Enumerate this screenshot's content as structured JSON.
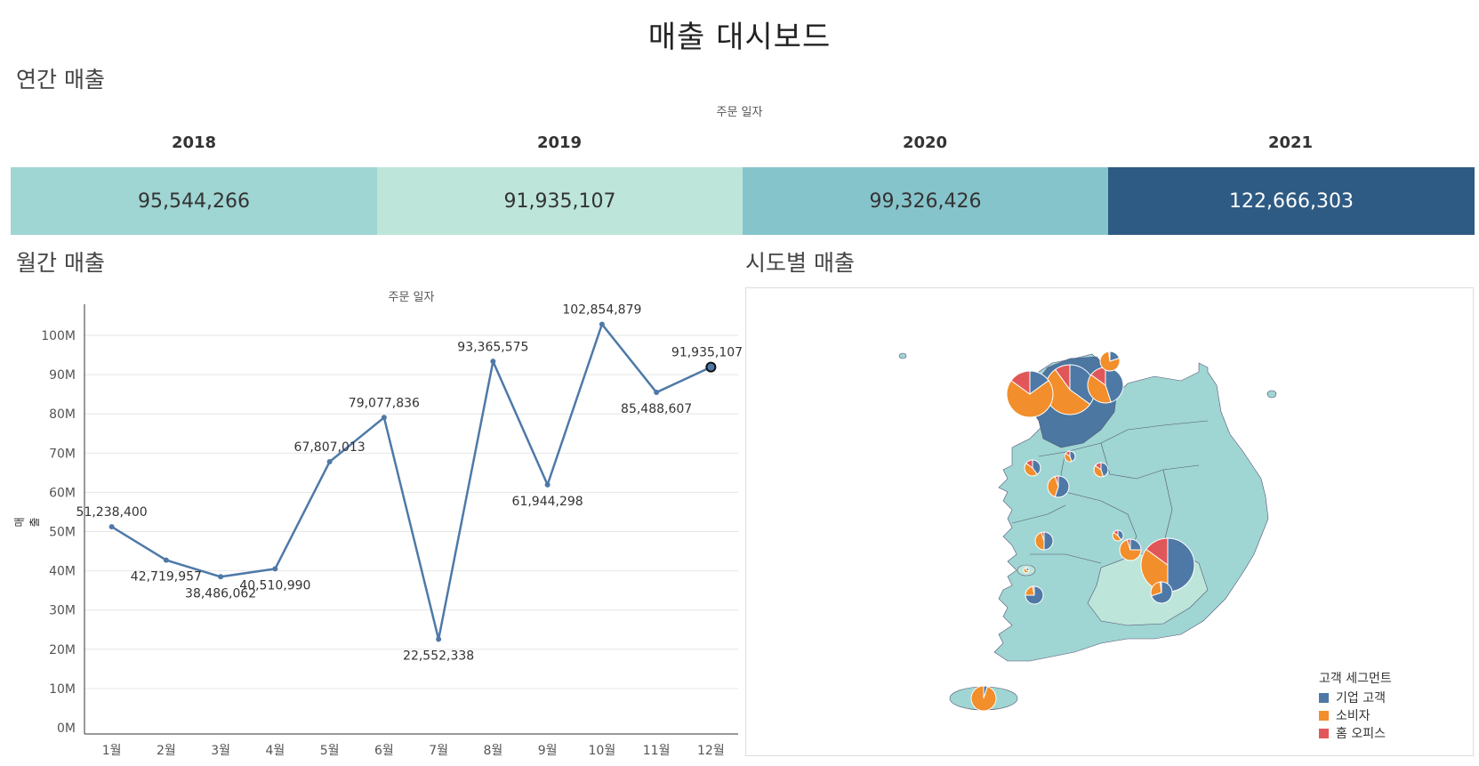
{
  "dashboard": {
    "title": "매출 대시보드"
  },
  "annual": {
    "section_title": "연간 매출",
    "axis_caption": "주문 일자",
    "years": [
      {
        "year": "2018",
        "value": "95,544,266",
        "color": "#9fd5d2",
        "text_color": "#333333"
      },
      {
        "year": "2019",
        "value": "91,935,107",
        "color": "#bde5da",
        "text_color": "#333333"
      },
      {
        "year": "2020",
        "value": "99,326,426",
        "color": "#86c4cb",
        "text_color": "#333333"
      },
      {
        "year": "2021",
        "value": "122,666,303",
        "color": "#2e5b84",
        "text_color": "#ffffff"
      }
    ]
  },
  "monthly": {
    "section_title": "월간 매출",
    "axis_caption": "주문 일자",
    "ylabel": "매출"
  },
  "map": {
    "section_title": "시도별 매출",
    "legend_title": "고객 세그먼트",
    "legend": [
      {
        "label": "기업 고객",
        "color": "#4e79a7"
      },
      {
        "label": "소비자",
        "color": "#f28e2b"
      },
      {
        "label": "홈 오피스",
        "color": "#e15759"
      }
    ]
  },
  "chart_data": {
    "type": "line",
    "categories": [
      "1월",
      "2월",
      "3월",
      "4월",
      "5월",
      "6월",
      "7월",
      "8월",
      "9월",
      "10월",
      "11월",
      "12월"
    ],
    "series": [
      {
        "values": [
          51238400,
          42719957,
          38486062,
          40510990,
          67807013,
          79077836,
          22552338,
          93365575,
          61944298,
          102854879,
          85488607,
          91935107
        ]
      }
    ],
    "data_labels": [
      "51,238,400",
      "42,719,957",
      "38,486,062",
      "40,510,990",
      "67,807,013",
      "79,077,836",
      "22,552,338",
      "93,365,575",
      "61,944,298",
      "102,854,879",
      "85,488,607",
      "91,935,107"
    ],
    "yticks": [
      "0M",
      "10M",
      "20M",
      "30M",
      "40M",
      "50M",
      "60M",
      "70M",
      "80M",
      "90M",
      "100M"
    ],
    "ylim": [
      0,
      105000000
    ],
    "xlabel": "주문 일자",
    "ylabel": "매출",
    "grid": true,
    "line_color": "#4e79a7"
  }
}
